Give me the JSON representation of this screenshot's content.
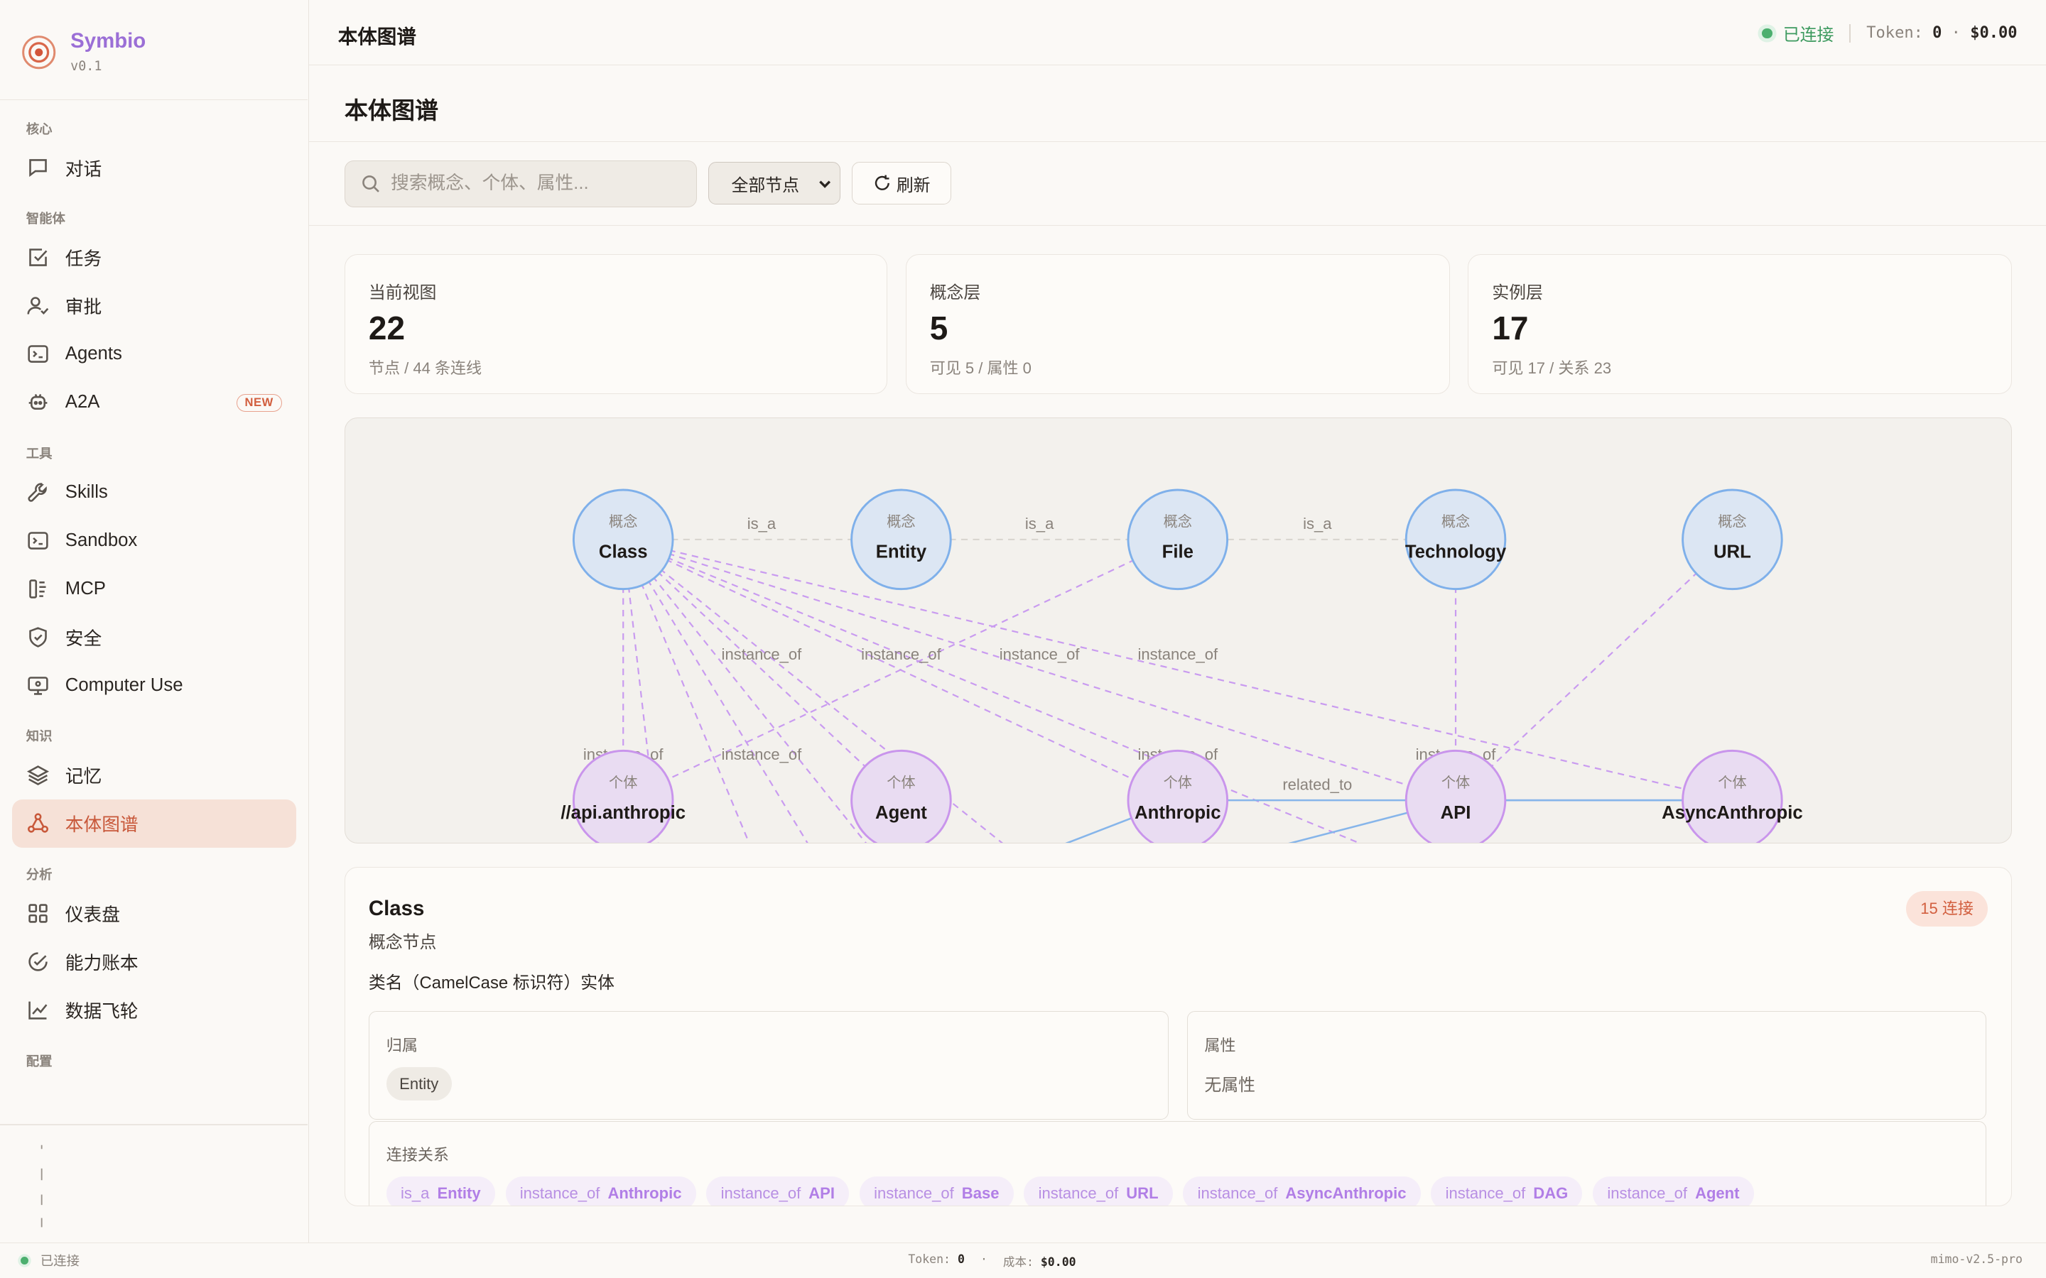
{
  "brand": {
    "name": "Symbio",
    "version": "v0.1"
  },
  "sidebar": {
    "sections": [
      {
        "title": "核心",
        "items": [
          {
            "label": "对话",
            "icon": "chat-icon"
          }
        ]
      },
      {
        "title": "智能体",
        "items": [
          {
            "label": "任务",
            "icon": "task-icon"
          },
          {
            "label": "审批",
            "icon": "approval-icon"
          },
          {
            "label": "Agents",
            "icon": "terminal-icon"
          },
          {
            "label": "A2A",
            "icon": "a2a-icon",
            "badge": "NEW"
          }
        ]
      },
      {
        "title": "工具",
        "items": [
          {
            "label": "Skills",
            "icon": "wrench-icon"
          },
          {
            "label": "Sandbox",
            "icon": "terminal-icon"
          },
          {
            "label": "MCP",
            "icon": "plug-icon"
          },
          {
            "label": "安全",
            "icon": "shield-icon"
          },
          {
            "label": "Computer Use",
            "icon": "monitor-icon"
          }
        ]
      },
      {
        "title": "知识",
        "items": [
          {
            "label": "记忆",
            "icon": "layers-icon"
          },
          {
            "label": "本体图谱",
            "icon": "graph-icon",
            "active": true
          }
        ]
      },
      {
        "title": "分析",
        "items": [
          {
            "label": "仪表盘",
            "icon": "dashboard-icon"
          },
          {
            "label": "能力账本",
            "icon": "ledger-icon"
          },
          {
            "label": "数据飞轮",
            "icon": "chart-line-icon"
          }
        ]
      },
      {
        "title": "配置",
        "items": []
      }
    ]
  },
  "topbar": {
    "title": "本体图谱",
    "status": "已连接",
    "token_label": "Token:",
    "token_value": "0",
    "cost_value": "$0.00"
  },
  "page": {
    "title": "本体图谱"
  },
  "toolbar": {
    "search_placeholder": "搜索概念、个体、属性...",
    "filter_selected": "全部节点",
    "refresh_label": "刷新"
  },
  "stats": [
    {
      "label": "当前视图",
      "value": "22",
      "sub": "节点 / 44 条连线"
    },
    {
      "label": "概念层",
      "value": "5",
      "sub": "可见 5 / 属性 0"
    },
    {
      "label": "实例层",
      "value": "17",
      "sub": "可见 17 / 关系 23"
    }
  ],
  "graph": {
    "colors": {
      "concept_fill": "#dce6f3",
      "concept_stroke": "#7fb0ea",
      "instance_fill": "#e9dcf2",
      "instance_stroke": "#c995ec",
      "edge_instance": "#c99bf0",
      "edge_related": "#86b5ea"
    },
    "concept_tag": "概念",
    "instance_tag": "个体",
    "concepts": [
      "Class",
      "Entity",
      "File",
      "Technology",
      "URL"
    ],
    "instances": [
      "//api.anthropic",
      "Agent",
      "Anthropic",
      "API",
      "AsyncAnthropic"
    ],
    "edge_labels": {
      "is_a": "is_a",
      "instance_of": "instance_of",
      "related_to": "related_to"
    }
  },
  "detail": {
    "title": "Class",
    "kind": "概念节点",
    "description": "类名（CamelCase 标识符）实体",
    "badge": "15 连接",
    "belongs_label": "归属",
    "belongs_value": "Entity",
    "props_label": "属性",
    "props_value": "无属性",
    "relations_label": "连接关系",
    "relations": [
      {
        "type": "is_a",
        "target": "Entity"
      },
      {
        "type": "instance_of",
        "target": "Anthropic"
      },
      {
        "type": "instance_of",
        "target": "API"
      },
      {
        "type": "instance_of",
        "target": "Base"
      },
      {
        "type": "instance_of",
        "target": "URL"
      },
      {
        "type": "instance_of",
        "target": "AsyncAnthropic"
      },
      {
        "type": "instance_of",
        "target": "DAG"
      },
      {
        "type": "instance_of",
        "target": "Agent"
      }
    ]
  },
  "footer": {
    "status": "已连接",
    "token_label": "Token:",
    "token_value": "0",
    "cost_label": "成本:",
    "cost_value": "$0.00",
    "model": "mimo-v2.5-pro"
  }
}
